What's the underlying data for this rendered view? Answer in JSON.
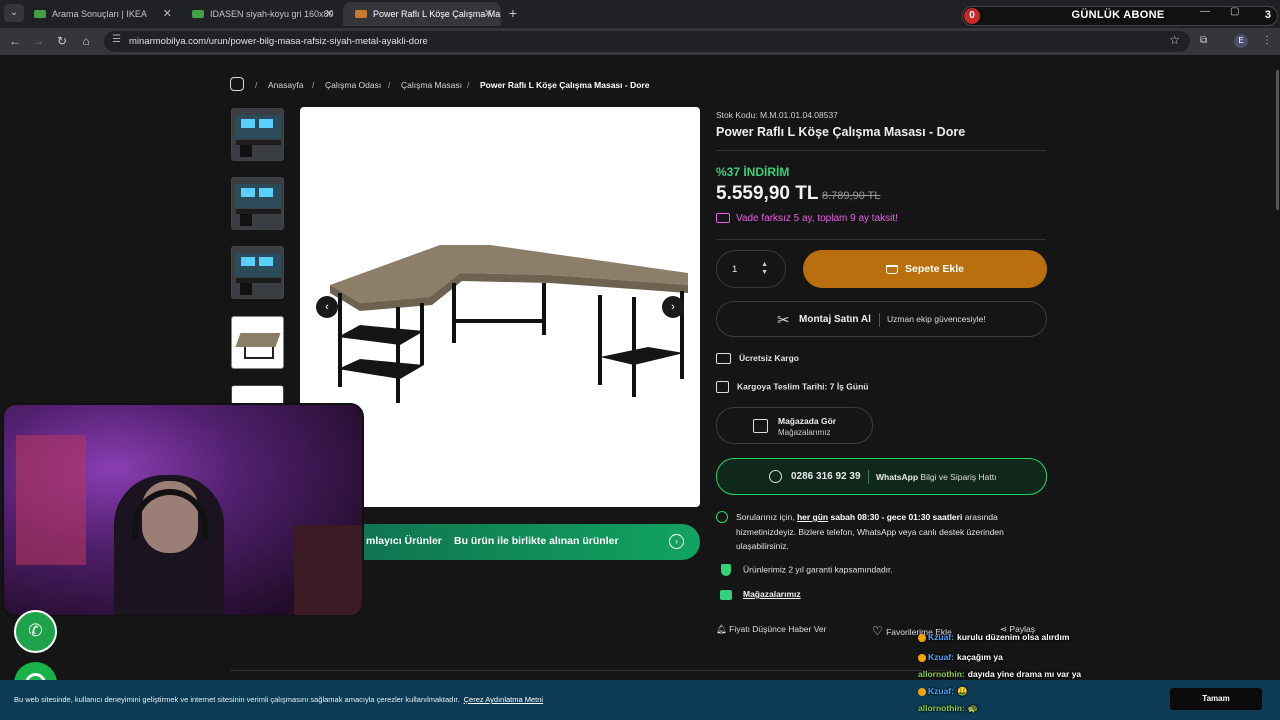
{
  "browser": {
    "tabs": [
      {
        "title": "Arama Sonuçları | IKEA",
        "favicon_color": "#43a047"
      },
      {
        "title": "IDASEN siyah-koyu gri 160x80",
        "favicon_color": "#43a047"
      },
      {
        "title": "Power Raflı L Köşe Çalışma Ma",
        "favicon_color": "#c97a2b"
      }
    ],
    "new_tab_label": "+",
    "url": "minarmobilya.com/urun/power-bilg-masa-rafsiz-siyah-metal-ayakli-dore",
    "profile_initial": "E"
  },
  "subscriber_widget": {
    "left_count": "0",
    "title": "GÜNLÜK ABONE",
    "right_count": "3"
  },
  "breadcrumb": {
    "items": [
      "Anasayfa",
      "Çalışma Odası",
      "Çalışma Masası",
      "Power Raflı L Köşe Çalışma Masası - Dore"
    ],
    "separator": "/"
  },
  "product": {
    "sku": "Stok Kodu: M.M.01.01.04.08537",
    "title": "Power Raflı L Köşe Çalışma Masası - Dore",
    "discount": "%37 İNDİRİM",
    "price": "5.559,90 TL",
    "old_price": "8.789,90 TL",
    "installment": "Vade farksız 5 ay, toplam 9 ay taksit!",
    "quantity": "1",
    "add_to_cart": "Sepete Ekle",
    "mount": {
      "label": "Montaj Satın Al",
      "sub": "Uzman ekip güvencesiyle!"
    },
    "shipping": [
      "Ücretsiz Kargo",
      "Kargoya Teslim Tarihi: 7 İş Günü"
    ],
    "store": {
      "title": "Mağazada Gör",
      "sub": "Mağazalarımız"
    },
    "whatsapp": {
      "phone": "0286 316 92 39",
      "brand": "WhatsApp",
      "sub": "Bilgi ve Sipariş Hattı"
    },
    "support": {
      "prefix": "Sorularınız için, ",
      "bold1": "her gün",
      "bold2": "sabah 08:30 - gece 01:30 saatleri",
      "rest": " arasında hizmetinizdeyiz. Bizlere telefon, WhatsApp veya canlı destek üzerinden ulaşabilirsiniz."
    },
    "warranty": "Ürünlerimiz 2 yıl garanti kapsamındadır.",
    "stores_link": "Mağazalarımız",
    "actions": [
      "Fiyatı Düşünce Haber Ver",
      "Favorilerime Ekle",
      "Paylaş"
    ]
  },
  "gallery": {
    "prev": "‹",
    "next": "›"
  },
  "tabs_bar": {
    "left": "mlayıcı Ürünler",
    "right": "Bu ürün ile birlikte alınan ürünler"
  },
  "cookie": {
    "text": "Bu web sitesinde, kullanıcı deneyimini geliştirmek ve internet sitesinin verimli çalışmasını sağlamak amacıyla çerezler kullanılmaktadır.",
    "link": "Çerez Aydınlatma Metni",
    "button": "Tamam"
  },
  "chat": [
    {
      "user": "Kzuaf:",
      "message": "kurulu düzenim olsa alırdım",
      "color": "#4ea3ff"
    },
    {
      "user": "Kzuaf:",
      "message": "kaçağım ya",
      "color": "#4ea3ff"
    },
    {
      "user": "allornothin:",
      "message": "dayıda yine drama mı var ya",
      "color": "#8bd14b"
    },
    {
      "user": "Kzuaf:",
      "message": "🤑",
      "color": "#4ea3ff"
    },
    {
      "user": "allornothin:",
      "message": "🐢",
      "color": "#8bd14b"
    }
  ],
  "icons": [
    "menu-icon",
    "back-icon",
    "forward-icon",
    "reload-icon",
    "home-icon",
    "site-info-icon",
    "star-icon",
    "extensions-icon",
    "kebab-icon",
    "home-outline-icon",
    "chevron-left-icon",
    "chevron-right-icon",
    "megaphone-icon",
    "cart-icon",
    "tools-icon",
    "truck-icon",
    "box-icon",
    "store-icon",
    "whatsapp-icon",
    "headset-icon",
    "shield-icon",
    "shop-icon",
    "bell-icon",
    "heart-icon",
    "share-icon",
    "phone-icon",
    "chat-icon"
  ]
}
